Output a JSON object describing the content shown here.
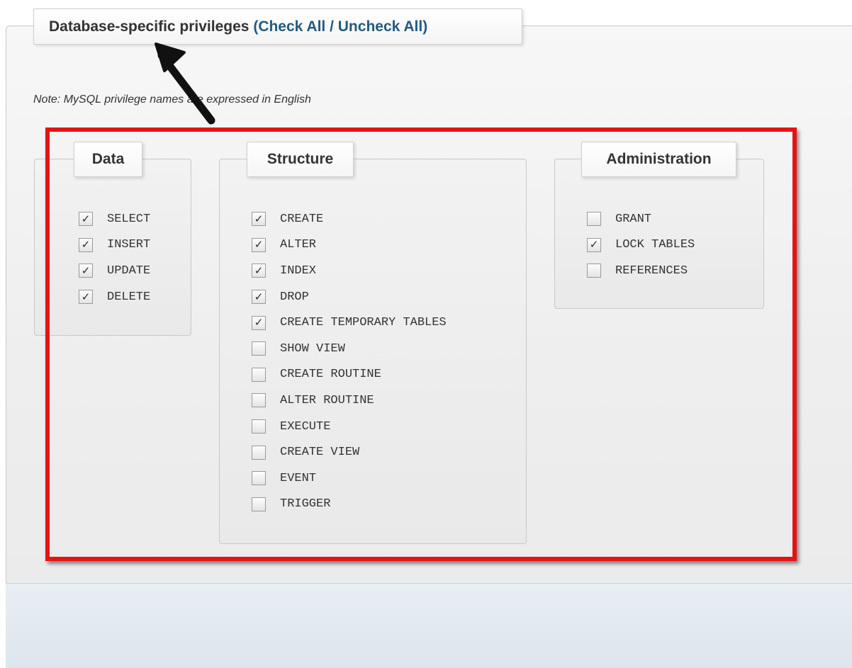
{
  "main_fieldset": {
    "legend_title": "Database-specific privileges",
    "open_paren": "(",
    "check_all": "Check All",
    "separator": "/",
    "uncheck_all": "Uncheck All",
    "close_paren": ")"
  },
  "note": "Note: MySQL privilege names are expressed in English",
  "groups": {
    "data": {
      "title": "Data",
      "items": [
        {
          "label": "SELECT",
          "checked": true
        },
        {
          "label": "INSERT",
          "checked": true
        },
        {
          "label": "UPDATE",
          "checked": true
        },
        {
          "label": "DELETE",
          "checked": true
        }
      ]
    },
    "structure": {
      "title": "Structure",
      "items": [
        {
          "label": "CREATE",
          "checked": true
        },
        {
          "label": "ALTER",
          "checked": true
        },
        {
          "label": "INDEX",
          "checked": true
        },
        {
          "label": "DROP",
          "checked": true
        },
        {
          "label": "CREATE TEMPORARY TABLES",
          "checked": true
        },
        {
          "label": "SHOW VIEW",
          "checked": false
        },
        {
          "label": "CREATE ROUTINE",
          "checked": false
        },
        {
          "label": "ALTER ROUTINE",
          "checked": false
        },
        {
          "label": "EXECUTE",
          "checked": false
        },
        {
          "label": "CREATE VIEW",
          "checked": false
        },
        {
          "label": "EVENT",
          "checked": false
        },
        {
          "label": "TRIGGER",
          "checked": false
        }
      ]
    },
    "administration": {
      "title": "Administration",
      "items": [
        {
          "label": "GRANT",
          "checked": false
        },
        {
          "label": "LOCK TABLES",
          "checked": true
        },
        {
          "label": "REFERENCES",
          "checked": false
        }
      ]
    }
  },
  "check_glyph": "✓",
  "colors": {
    "link": "#235a81",
    "highlight": "#e41414",
    "arrow": "#111111"
  },
  "icons": {
    "annotation_arrow": "arrow-up-left-icon",
    "checkbox": "checkbox-icon"
  }
}
